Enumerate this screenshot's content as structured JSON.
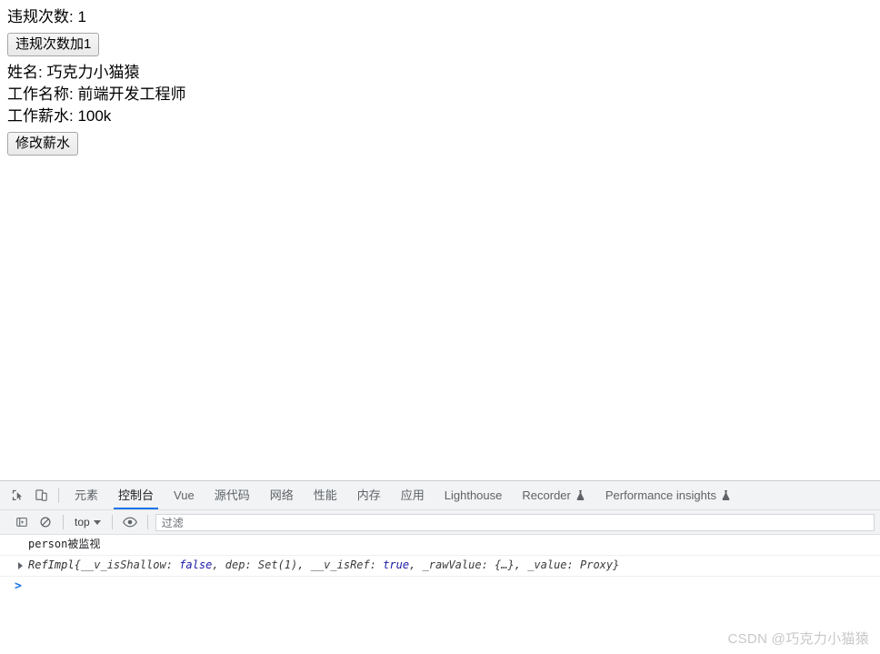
{
  "page": {
    "lines": [
      {
        "id": "violation-count",
        "text": "违规次数: 1"
      },
      {
        "id": "name",
        "text": "姓名: 巧克力小猫猿"
      },
      {
        "id": "job-name",
        "text": "工作名称: 前端开发工程师"
      },
      {
        "id": "job-salary",
        "text": "工作薪水: 100k"
      }
    ],
    "violation_label": "违规次数: 1",
    "name_label": "姓名: 巧克力小猫猿",
    "job_name_label": "工作名称: 前端开发工程师",
    "job_salary_label": "工作薪水: 100k",
    "increment_button": "违规次数加1",
    "change_salary_button": "修改薪水"
  },
  "devtools": {
    "tabs": [
      {
        "label": "元素",
        "active": false,
        "flask": false
      },
      {
        "label": "控制台",
        "active": true,
        "flask": false
      },
      {
        "label": "Vue",
        "active": false,
        "flask": false
      },
      {
        "label": "源代码",
        "active": false,
        "flask": false
      },
      {
        "label": "网络",
        "active": false,
        "flask": false
      },
      {
        "label": "性能",
        "active": false,
        "flask": false
      },
      {
        "label": "内存",
        "active": false,
        "flask": false
      },
      {
        "label": "应用",
        "active": false,
        "flask": false
      },
      {
        "label": "Lighthouse",
        "active": false,
        "flask": false
      },
      {
        "label": "Recorder",
        "active": false,
        "flask": true
      },
      {
        "label": "Performance insights",
        "active": false,
        "flask": true
      }
    ],
    "console_toolbar": {
      "context": "top",
      "filter_placeholder": "过滤"
    },
    "console_messages": [
      {
        "type": "log",
        "text": "person被监视"
      },
      {
        "type": "object",
        "class_name": "RefImpl",
        "open_brace": "{",
        "close_brace": "}",
        "props": [
          {
            "key": "__v_isShallow",
            "value": "false",
            "kind": "bool"
          },
          {
            "key": "dep",
            "value": "Set(1)",
            "kind": "plain"
          },
          {
            "key": "__v_isRef",
            "value": "true",
            "kind": "bool"
          },
          {
            "key": "_rawValue",
            "value": "{…}",
            "kind": "plain"
          },
          {
            "key": "_value",
            "value": "Proxy",
            "kind": "plain"
          }
        ]
      }
    ],
    "prompt_symbol": ">"
  },
  "watermark": {
    "text": "CSDN @巧克力小猫猿"
  },
  "colors": {
    "accent": "#1a73e8",
    "toolbar_bg": "#f1f3f4",
    "text": "#5f6368",
    "boolean": "#1a1aa6",
    "watermark": "#c8c8c8"
  }
}
